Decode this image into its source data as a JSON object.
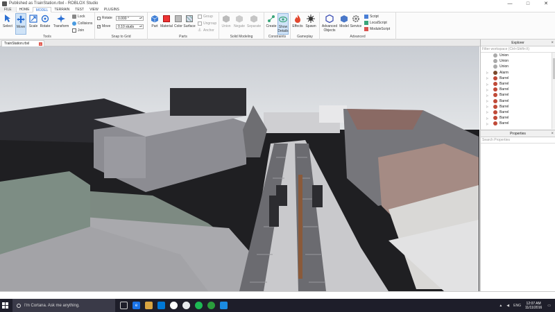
{
  "window": {
    "title": "Published as TrainStation.rbxl - ROBLOX Studio",
    "min": "—",
    "max": "□",
    "close": "✕"
  },
  "tabs": [
    "FILE",
    "HOME",
    "MODEL",
    "TERRAIN",
    "TEST",
    "VIEW",
    "PLUGINS"
  ],
  "active_tab": "MODEL",
  "ribbon": {
    "tools": {
      "group": "Tools",
      "select": "Select",
      "move": "Move",
      "scale": "Scale",
      "rotate": "Rotate",
      "transform": "Transform",
      "lock": "Lock",
      "collisions": "Collisions",
      "join": "Join"
    },
    "snap": {
      "group": "Snap to Grid",
      "rotate_label": "Rotate",
      "rotate_value": "0.000 °",
      "move_label": "Move",
      "move_value": "0.10 studs"
    },
    "parts": {
      "group": "Parts",
      "part": "Part",
      "material": "Material",
      "color": "Color",
      "surface": "Surface",
      "group_btn": "Group",
      "ungroup": "Ungroup",
      "anchor": "Anchor"
    },
    "solid": {
      "group": "Solid Modeling",
      "union": "Union",
      "negate": "Negate",
      "separate": "Separate"
    },
    "constraints": {
      "group": "Constraints",
      "create": "Create",
      "show": "Show",
      "details": "Details"
    },
    "gameplay": {
      "group": "Gameplay",
      "effects": "Effects",
      "spawn": "Spawn"
    },
    "advanced": {
      "group": "Advanced",
      "advanced_objects_1": "Advanced",
      "advanced_objects_2": "Objects",
      "model": "Model",
      "service": "Service",
      "script": "Script",
      "localscript": "LocalScript",
      "modulescript": "ModuleScript"
    }
  },
  "doc_tab": {
    "name": "TrainStation.rbxl",
    "close": "×"
  },
  "explorer": {
    "title": "Explorer",
    "filter_placeholder": "Filter workspace (Ctrl+Shift+X)",
    "items": [
      {
        "name": "Union",
        "type": "union"
      },
      {
        "name": "Union",
        "type": "union"
      },
      {
        "name": "Union",
        "type": "union"
      },
      {
        "name": "Alarm",
        "type": "alarm"
      },
      {
        "name": "Barrel",
        "type": "barrel"
      },
      {
        "name": "Barrel",
        "type": "barrel"
      },
      {
        "name": "Barrel",
        "type": "barrel"
      },
      {
        "name": "Barrel",
        "type": "barrel"
      },
      {
        "name": "Barrel",
        "type": "barrel"
      },
      {
        "name": "Barrel",
        "type": "barrel"
      },
      {
        "name": "Barrel",
        "type": "barrel"
      },
      {
        "name": "Barrel",
        "type": "barrel"
      },
      {
        "name": "Barrel",
        "type": "barrel"
      }
    ]
  },
  "properties": {
    "title": "Properties",
    "search_placeholder": "Search Properties"
  },
  "taskbar": {
    "search": "I'm Cortana. Ask me anything.",
    "lang": "ENG",
    "time": "12:07 AM",
    "date": "11/11/2016"
  },
  "colors": {
    "accent": "#2a6fd3",
    "taskbar": "#1e1e2a",
    "barrel": "#c04a38"
  }
}
